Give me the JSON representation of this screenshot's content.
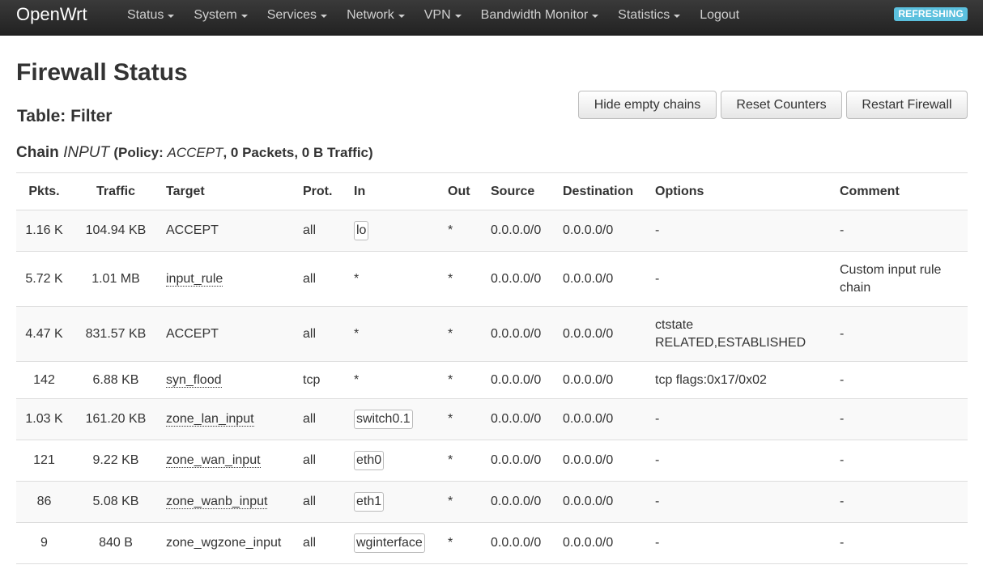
{
  "navbar": {
    "brand": "OpenWrt",
    "menu": [
      {
        "label": "Status",
        "dropdown": true
      },
      {
        "label": "System",
        "dropdown": true
      },
      {
        "label": "Services",
        "dropdown": true
      },
      {
        "label": "Network",
        "dropdown": true
      },
      {
        "label": "VPN",
        "dropdown": true
      },
      {
        "label": "Bandwidth Monitor",
        "dropdown": true
      },
      {
        "label": "Statistics",
        "dropdown": true
      },
      {
        "label": "Logout",
        "dropdown": false
      }
    ],
    "status_badge": "REFRESHING",
    "badge_color": "#5bc0de"
  },
  "page": {
    "title": "Firewall Status",
    "table_title": "Table: Filter",
    "chain": {
      "prefix": "Chain",
      "name": "INPUT",
      "policy_open": "(Policy:",
      "policy": "ACCEPT",
      "stats": ", 0 Packets, 0 B Traffic)"
    }
  },
  "actions": {
    "hide_empty": "Hide empty chains",
    "reset_counters": "Reset Counters",
    "restart_firewall": "Restart Firewall"
  },
  "table": {
    "headers": [
      "Pkts.",
      "Traffic",
      "Target",
      "Prot.",
      "In",
      "Out",
      "Source",
      "Destination",
      "Options",
      "Comment"
    ],
    "rows": [
      {
        "pkts": "1.16 K",
        "traffic": "104.94 KB",
        "target": "ACCEPT",
        "target_link": false,
        "prot": "all",
        "in": "lo",
        "in_iface": true,
        "out": "*",
        "source": "0.0.0.0/0",
        "destination": "0.0.0.0/0",
        "options": "-",
        "comment": "-"
      },
      {
        "pkts": "5.72 K",
        "traffic": "1.01 MB",
        "target": "input_rule",
        "target_link": true,
        "prot": "all",
        "in": "*",
        "in_iface": false,
        "out": "*",
        "source": "0.0.0.0/0",
        "destination": "0.0.0.0/0",
        "options": "-",
        "comment": "Custom input rule chain"
      },
      {
        "pkts": "4.47 K",
        "traffic": "831.57 KB",
        "target": "ACCEPT",
        "target_link": false,
        "prot": "all",
        "in": "*",
        "in_iface": false,
        "out": "*",
        "source": "0.0.0.0/0",
        "destination": "0.0.0.0/0",
        "options": "ctstate RELATED,ESTABLISHED",
        "comment": "-"
      },
      {
        "pkts": "142",
        "traffic": "6.88 KB",
        "target": "syn_flood",
        "target_link": true,
        "prot": "tcp",
        "in": "*",
        "in_iface": false,
        "out": "*",
        "source": "0.0.0.0/0",
        "destination": "0.0.0.0/0",
        "options": "tcp flags:0x17/0x02",
        "comment": "-"
      },
      {
        "pkts": "1.03 K",
        "traffic": "161.20 KB",
        "target": "zone_lan_input",
        "target_link": true,
        "prot": "all",
        "in": "switch0.1",
        "in_iface": true,
        "out": "*",
        "source": "0.0.0.0/0",
        "destination": "0.0.0.0/0",
        "options": "-",
        "comment": "-"
      },
      {
        "pkts": "121",
        "traffic": "9.22 KB",
        "target": "zone_wan_input",
        "target_link": true,
        "prot": "all",
        "in": "eth0",
        "in_iface": true,
        "out": "*",
        "source": "0.0.0.0/0",
        "destination": "0.0.0.0/0",
        "options": "-",
        "comment": "-"
      },
      {
        "pkts": "86",
        "traffic": "5.08 KB",
        "target": "zone_wanb_input",
        "target_link": true,
        "prot": "all",
        "in": "eth1",
        "in_iface": true,
        "out": "*",
        "source": "0.0.0.0/0",
        "destination": "0.0.0.0/0",
        "options": "-",
        "comment": "-"
      },
      {
        "pkts": "9",
        "traffic": "840 B",
        "target": "zone_wgzone_input",
        "target_link": false,
        "prot": "all",
        "in": "wginterface",
        "in_iface": true,
        "out": "*",
        "source": "0.0.0.0/0",
        "destination": "0.0.0.0/0",
        "options": "-",
        "comment": "-"
      }
    ]
  }
}
